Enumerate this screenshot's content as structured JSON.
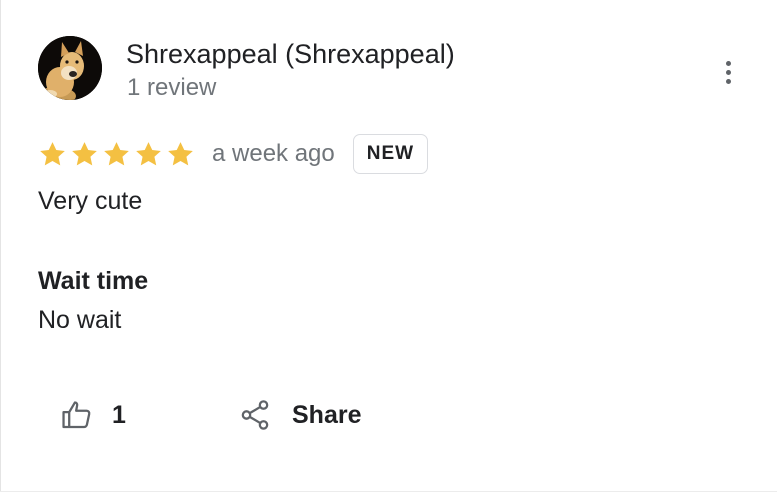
{
  "review": {
    "author_name": "Shrexappeal (Shrexappeal)",
    "author_meta": "1 review",
    "rating": 5,
    "rating_max": 5,
    "time": "a week ago",
    "badge": "NEW",
    "text": "Very cute",
    "attributes": [
      {
        "label": "Wait time",
        "value": "No wait"
      }
    ]
  },
  "actions": {
    "like_count": "1",
    "share_label": "Share"
  },
  "icons": {
    "more": "more-vert-icon",
    "star": "star-icon",
    "like": "thumb-up-icon",
    "share": "share-icon"
  },
  "colors": {
    "star": "#f4c042",
    "primary_text": "#202124",
    "secondary_text": "#70757a",
    "badge_border": "#dadce0",
    "icon": "#5f6368"
  }
}
